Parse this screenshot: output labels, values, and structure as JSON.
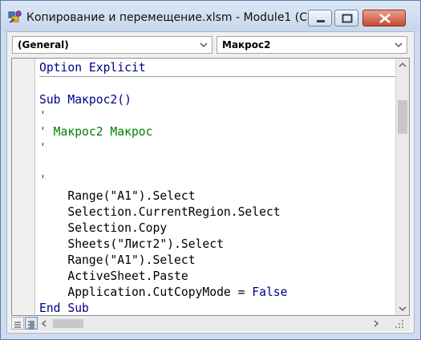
{
  "window": {
    "title": "Копирование и перемещение.xlsm - Module1 (C...",
    "icons": [
      "vba-editor-icon",
      "minimize-icon",
      "maximize-icon",
      "close-icon"
    ]
  },
  "object_combo": {
    "value": "(General)"
  },
  "procedure_combo": {
    "value": "Макрос2"
  },
  "code": {
    "line0": "Option Explicit",
    "line1": "Sub Макрос2()",
    "line2": "'",
    "line3": "' Макрос2 Макрос",
    "line4": "'",
    "line5": "",
    "line6": "'",
    "line7": "    Range(\"A1\").Select",
    "line8": "    Selection.CurrentRegion.Select",
    "line9": "    Selection.Copy",
    "line10": "    Sheets(\"Лист2\").Select",
    "line11": "    Range(\"A1\").Select",
    "line12": "    ActiveSheet.Paste",
    "line13": "    Application.CutCopyMode = ",
    "line13_keyword": "False",
    "line14": "End Sub"
  },
  "colors": {
    "keyword": "#00008b",
    "comment": "#008000",
    "text": "#000000",
    "close_button": "#c64a32"
  }
}
